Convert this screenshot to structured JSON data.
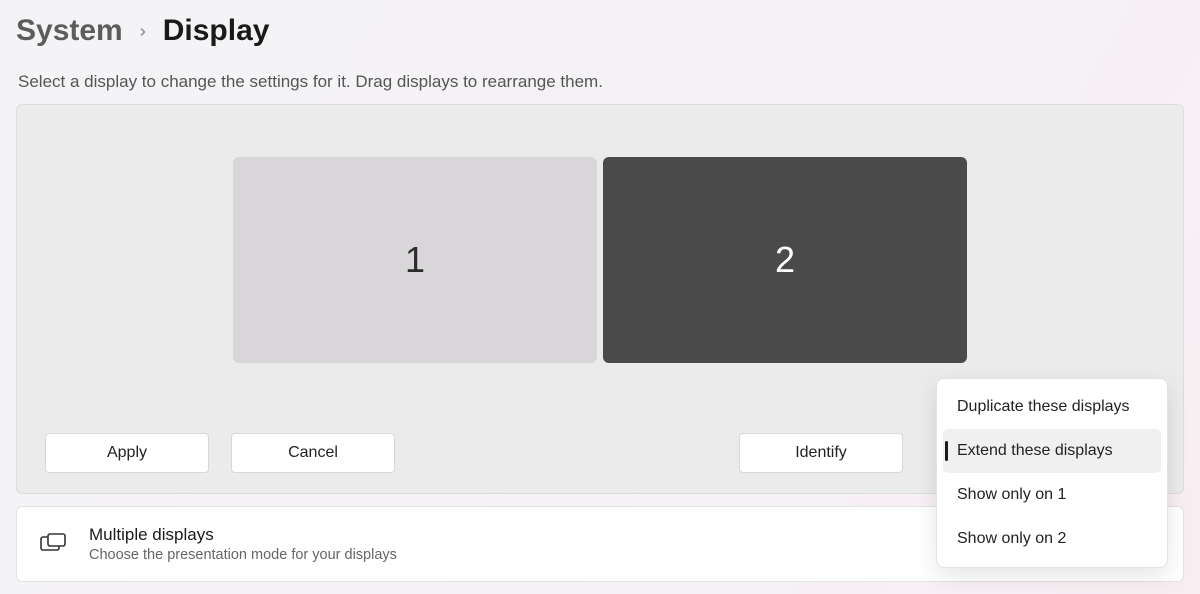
{
  "breadcrumb": {
    "parent": "System",
    "current": "Display"
  },
  "hint_text": "Select a display to change the settings for it. Drag displays to rearrange them.",
  "monitors": {
    "m1_label": "1",
    "m2_label": "2",
    "selected": 2
  },
  "panel_buttons": {
    "apply": "Apply",
    "cancel": "Cancel",
    "identify": "Identify"
  },
  "mode_dropdown": {
    "options": [
      "Duplicate these displays",
      "Extend these displays",
      "Show only on 1",
      "Show only on 2"
    ],
    "selected_index": 1
  },
  "tile": {
    "title": "Multiple displays",
    "subtitle": "Choose the presentation mode for your displays"
  }
}
